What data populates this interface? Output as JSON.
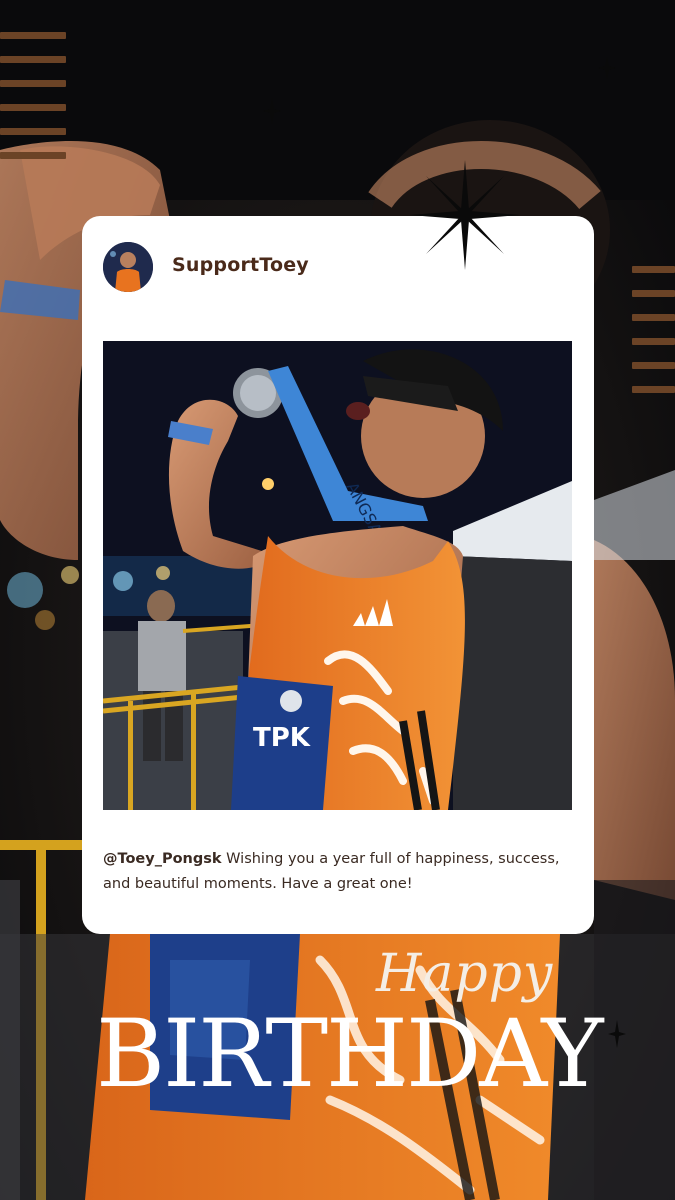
{
  "post": {
    "username": "SupportToey",
    "caption_mention": "@Toey_Pongsk",
    "caption_text": " Wishing you a year full of happiness, success, and beautiful moments. Have a great one!"
  },
  "greeting": {
    "line1": "Happy",
    "line2": "BIRTHDAY"
  },
  "photo_text": {
    "lanyard": "ANGSAEN21",
    "bib": "TPK"
  },
  "colors": {
    "card_bg": "#ffffff",
    "username": "#4a2a1a",
    "caption": "#3a2a22",
    "accent_bars": "#6b4326",
    "singlet_orange": "#e8731f",
    "background": "#0b0b0d"
  },
  "icons": [
    "sparkle-icon",
    "starburst-icon",
    "decorative-bars"
  ]
}
